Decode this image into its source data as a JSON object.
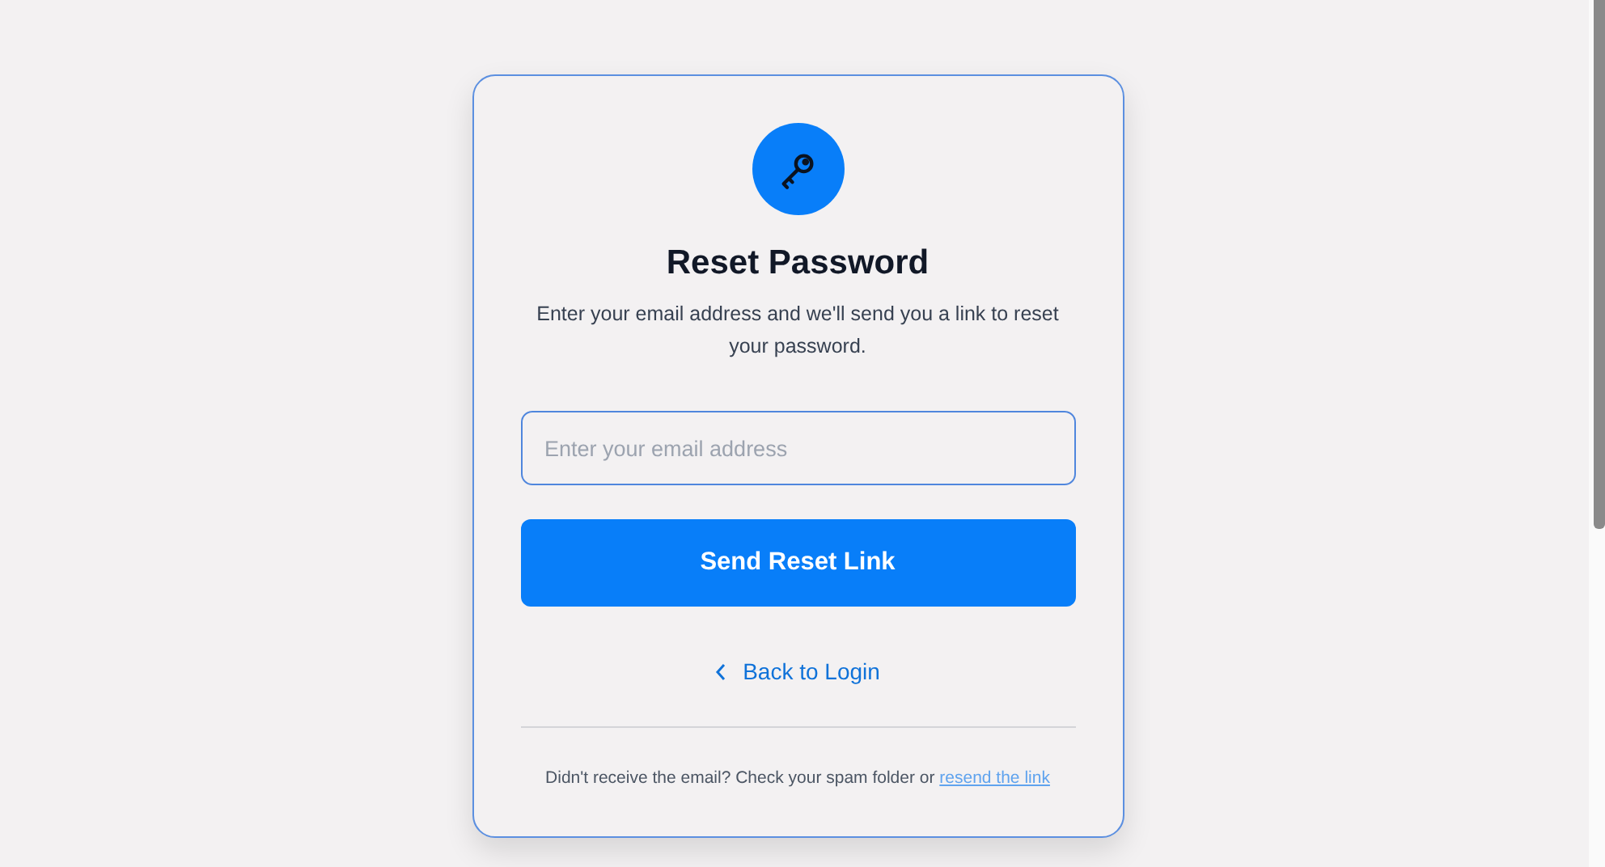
{
  "card": {
    "title": "Reset Password",
    "description": "Enter your email address and we'll send you a link to reset your password.",
    "email_field": {
      "placeholder": "Enter your email address"
    },
    "submit_button": {
      "label": "Send Reset Link"
    },
    "back_link": {
      "label": "Back to Login"
    },
    "footer": {
      "text": "Didn't receive the email? Check your spam folder or",
      "link": "resend the link"
    }
  }
}
